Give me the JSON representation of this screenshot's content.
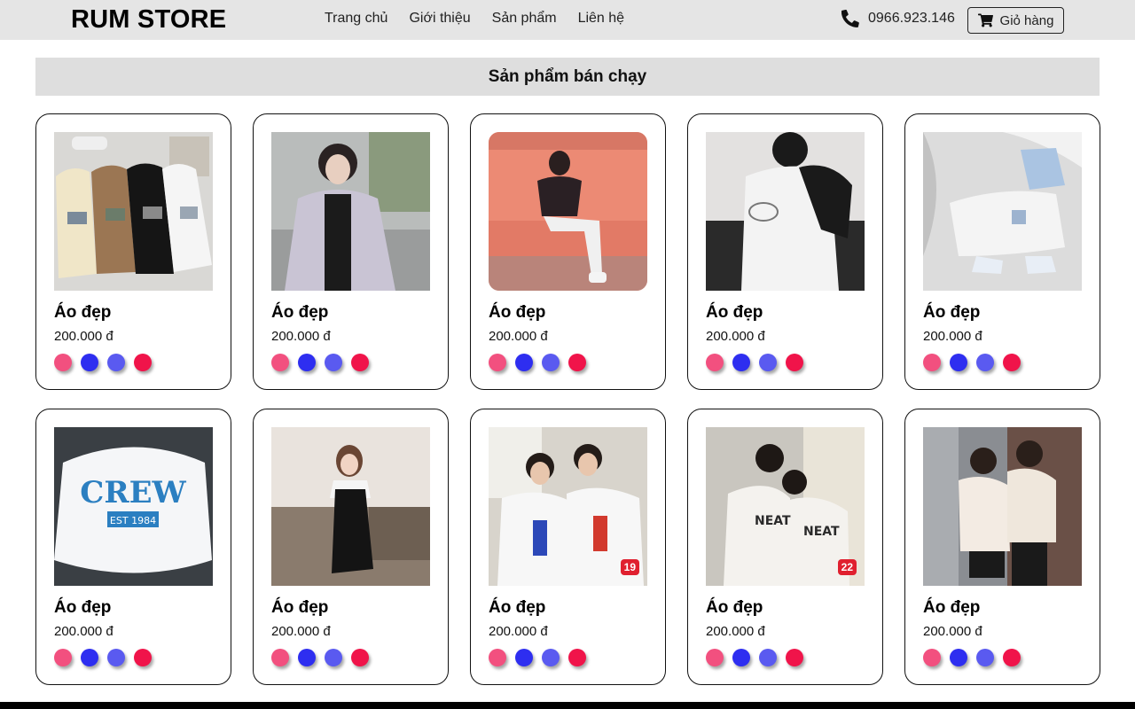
{
  "header": {
    "logo": "RUM STORE",
    "nav": [
      "Trang chủ",
      "Giới thiệu",
      "Sản phẩm",
      "Liên hệ"
    ],
    "phone": "0966.923.146",
    "cart_label": "Giỏ hàng"
  },
  "section": {
    "title": "Sản phẩm bán chạy"
  },
  "swatch_colors": [
    "#f2507f",
    "#2e2ef0",
    "#5a5af0",
    "#f0144a"
  ],
  "products": [
    {
      "name": "Áo đẹp",
      "price": "200.000 đ",
      "image": "hoodies-photo",
      "badge": ""
    },
    {
      "name": "Áo đẹp",
      "price": "200.000 đ",
      "image": "grey-hoodie-girl-photo",
      "badge": ""
    },
    {
      "name": "Áo đẹp",
      "price": "200.000 đ",
      "image": "girl-on-pink-wall-photo",
      "badge": ""
    },
    {
      "name": "Áo đẹp",
      "price": "200.000 đ",
      "image": "baseball-jacket-photo",
      "badge": ""
    },
    {
      "name": "Áo đẹp",
      "price": "200.000 đ",
      "image": "jogger-pants-photo",
      "badge": ""
    },
    {
      "name": "Áo đẹp",
      "price": "200.000 đ",
      "image": "crew-sweatshirt-photo",
      "badge": ""
    },
    {
      "name": "Áo đẹp",
      "price": "200.000 đ",
      "image": "black-dress-photo",
      "badge": ""
    },
    {
      "name": "Áo đẹp",
      "price": "200.000 đ",
      "image": "couple-sweatshirts-photo",
      "badge": "19"
    },
    {
      "name": "Áo đẹp",
      "price": "200.000 đ",
      "image": "couple-neat-account-photo",
      "badge": "22"
    },
    {
      "name": "Áo đẹp",
      "price": "200.000 đ",
      "image": "couple-hoodies-photo",
      "badge": ""
    }
  ]
}
